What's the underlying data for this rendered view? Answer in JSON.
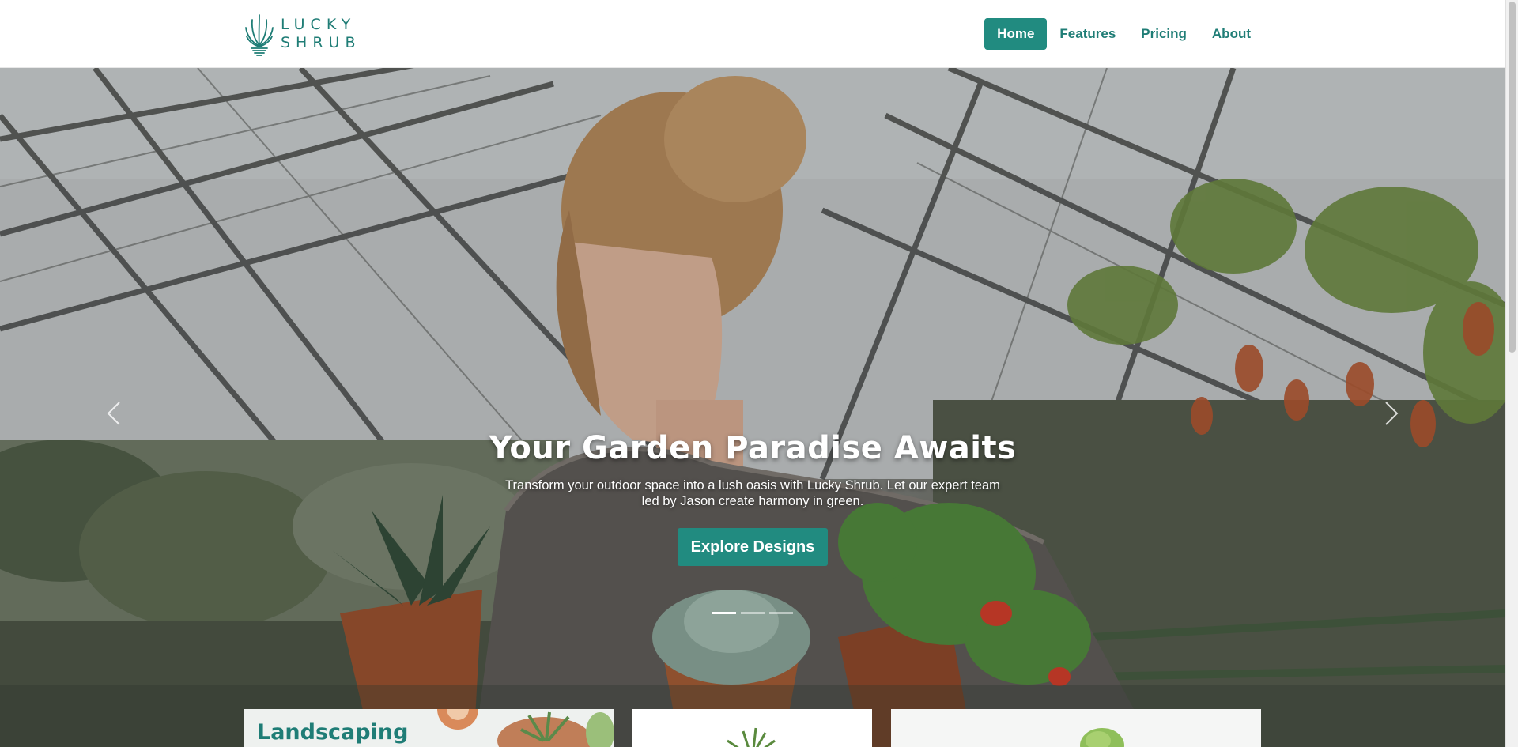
{
  "brand": {
    "line1": "LUCKY",
    "line2": "SHRUB",
    "logo_icon": "aloe-plant-icon",
    "color": "#1f7d76"
  },
  "nav": {
    "items": [
      {
        "label": "Home",
        "active": true
      },
      {
        "label": "Features",
        "active": false
      },
      {
        "label": "Pricing",
        "active": false
      },
      {
        "label": "About",
        "active": false
      }
    ],
    "active_bg": "#218b80"
  },
  "hero": {
    "title": "Your Garden Paradise Awaits",
    "subtitle": "Transform your outdoor space into a lush oasis with Lucky Shrub. Let our expert team led by Jason create harmony in green.",
    "cta_label": "Explore Designs",
    "prev_icon": "chevron-left-icon",
    "next_icon": "chevron-right-icon",
    "slide_count": 3,
    "active_slide": 1
  },
  "cards": [
    {
      "title": "Landscaping"
    },
    {
      "title": ""
    },
    {
      "title": ""
    }
  ]
}
